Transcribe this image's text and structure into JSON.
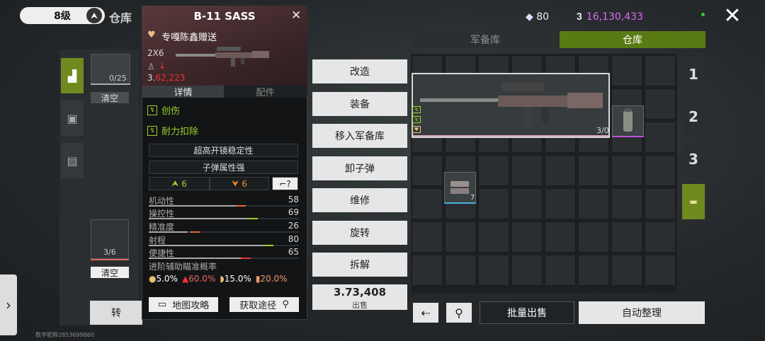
{
  "topbar": {
    "level": "8级",
    "title": "仓库",
    "gems": "80",
    "money": "16,130,433"
  },
  "tabs": {
    "armory": "军备库",
    "warehouse": "仓库"
  },
  "left": {
    "backpack_count": "0/25",
    "clear1": "清空",
    "robot_count": "3/6",
    "clear2": "清空",
    "turn_label": "转",
    "user_id": "数字昵称2853699860"
  },
  "popup": {
    "title": "B-11 SASS",
    "gift_text": "专嘎陈鑫赠送",
    "size": "2X6",
    "price": "62,223",
    "tab_details": "详情",
    "tab_parts": "配件",
    "traits": [
      "创伤",
      "耐力扣除"
    ],
    "attributes": [
      "超高开镜稳定性",
      "子弹属性强"
    ],
    "compare_up": "6",
    "compare_down": "6",
    "stats": [
      {
        "name": "机动性",
        "value": "58"
      },
      {
        "name": "操控性",
        "value": "69"
      },
      {
        "name": "精准度",
        "value": "26"
      },
      {
        "name": "射程",
        "value": "80"
      },
      {
        "name": "便捷性",
        "value": "65"
      }
    ],
    "aim_title": "进阶辅助瞄准概率",
    "aim": [
      "5.0%",
      "60.0%",
      "15.0%",
      "20.0%"
    ],
    "map_guide": "地图攻略",
    "acquire": "获取途径"
  },
  "actions": {
    "modify": "改造",
    "equip": "装备",
    "move_armory": "移入军备库",
    "unload": "卸子弹",
    "repair": "维修",
    "rotate": "旋转",
    "dismantle": "拆解",
    "sell_price": "73,408",
    "sell_label": "出售"
  },
  "grid": {
    "rifle_count": "3/0",
    "ammo_count": "7"
  },
  "right_tabs": [
    "1",
    "2",
    "3"
  ],
  "bottom": {
    "batch_sell": "批量出售",
    "auto_sort": "自动整理"
  },
  "colors": {
    "accent_green": "#6f8a1f",
    "trait_green": "#9cd12a",
    "money_purple": "#d96bf0",
    "warn_red": "#e33"
  }
}
